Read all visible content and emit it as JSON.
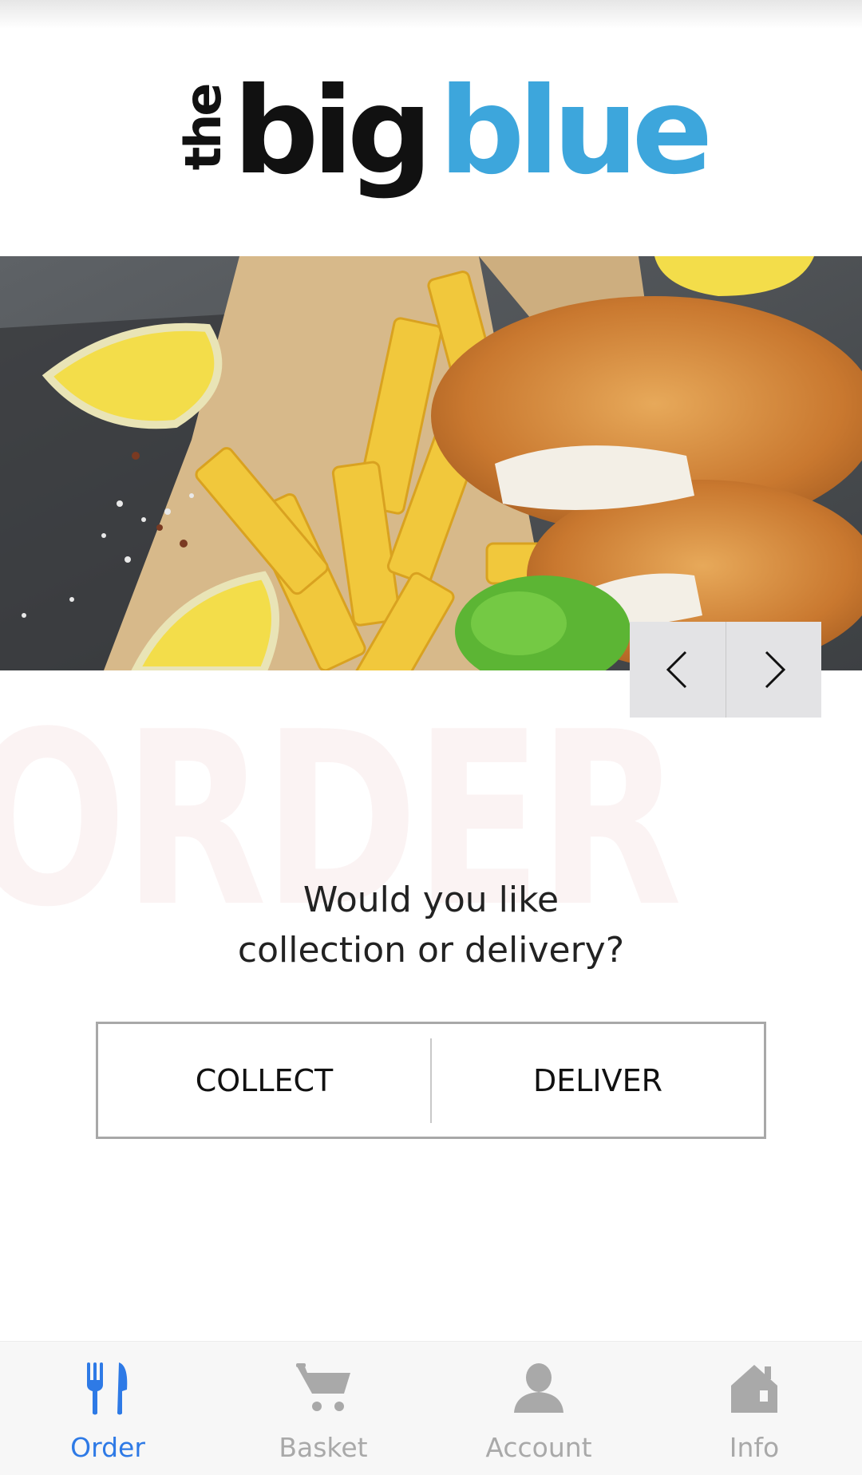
{
  "brand": {
    "logo_the": "the",
    "logo_big": "big",
    "logo_blue": "blue",
    "accent_color": "#3da6dc"
  },
  "hero": {
    "nav_prev_icon": "chevron-left-icon",
    "nav_next_icon": "chevron-right-icon"
  },
  "watermark": "ORDER",
  "question": {
    "line1": "Would you like",
    "line2": "collection or delivery?"
  },
  "choice": {
    "collect_label": "COLLECT",
    "deliver_label": "DELIVER"
  },
  "tabs": [
    {
      "label": "Order",
      "icon": "fork-knife-icon",
      "active": true
    },
    {
      "label": "Basket",
      "icon": "cart-icon",
      "active": false
    },
    {
      "label": "Account",
      "icon": "person-icon",
      "active": false
    },
    {
      "label": "Info",
      "icon": "house-icon",
      "active": false
    }
  ],
  "colors": {
    "active_tab": "#2e7ae6",
    "inactive_tab": "#a9a9a9"
  }
}
